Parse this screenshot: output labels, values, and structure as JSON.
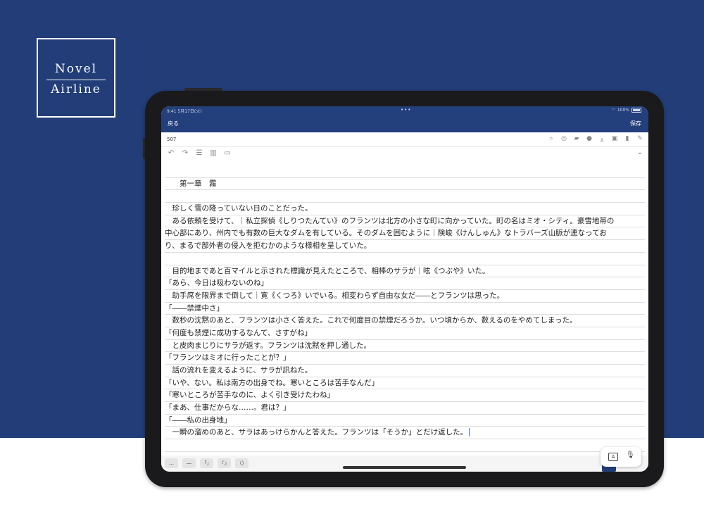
{
  "brand": {
    "line1": "Novel",
    "line2": "Airline"
  },
  "status": {
    "time": "9:41",
    "date": "5月17日(火)",
    "dots": "•••",
    "battery": "100%"
  },
  "nav": {
    "back": "戻る",
    "save": "保存"
  },
  "toolbar": {
    "count": "507",
    "icons": [
      "search-icon",
      "globe-icon",
      "clapper-icon",
      "person-icon",
      "ruby-icon",
      "image-icon",
      "trash-icon",
      "pencil-icon"
    ]
  },
  "toolbar2": {
    "icons": [
      "undo-icon",
      "redo-icon",
      "list-icon",
      "book-icon",
      "open-book-icon",
      "chevron-down-icon"
    ]
  },
  "document": {
    "lines": [
      "",
      "　　第一章　霧",
      "",
      "　珍しく雪の降っていない日のことだった。",
      "　ある依頼を受けて、｜私立探偵《しりつたんてい》のフランツは北方の小さな町に向かっていた。町の名はミオ・シティ。豪雪地帯の",
      "中心部にあり、州内でも有数の巨大なダムを有している。そのダムを囲むように｜険峻《けんしゅん》なトラバーズ山脈が連なってお",
      "り、まるで部外者の侵入を拒むかのような様相を呈していた。",
      "",
      "　目的地まであと百マイルと示された標識が見えたところで、相棒のサラが｜呟《つぶや》いた。",
      "「あら、今日は吸わないのね」",
      "　助手席を限界まで倒して｜寛《くつろ》いでいる。相変わらず自由な女だ――とフランツは思った。",
      "「――禁煙中さ」",
      "　数秒の沈黙のあと、フランツは小さく答えた。これで何度目の禁煙だろうか。いつ頃からか、数えるのをやめてしまった。",
      "「何度も禁煙に成功するなんて、さすがね」",
      "　と皮肉まじりにサラが返す。フランツは沈黙を押し通した。",
      "「フランツはミオに行ったことが？」",
      "　話の流れを変えるように、サラが訊ねた。",
      "「いや、ない。私は南方の出身でね。寒いところは苦手なんだ」",
      "「寒いところが苦手なのに、よく引き受けたわね」",
      "「まあ、仕事だからな……。君は？」",
      "「――私の出身地」",
      "　一瞬の溜めのあと、サラはあっけらかんと答えた。フランツは「そうか」とだけ返した。",
      ""
    ]
  },
  "keybar": {
    "keys": [
      "…",
      "―",
      "「」",
      "『』",
      "（）"
    ]
  },
  "dictation": {
    "keyboard_label": "A"
  },
  "colors": {
    "navy": "#223d78",
    "accent": "#233f7c"
  }
}
